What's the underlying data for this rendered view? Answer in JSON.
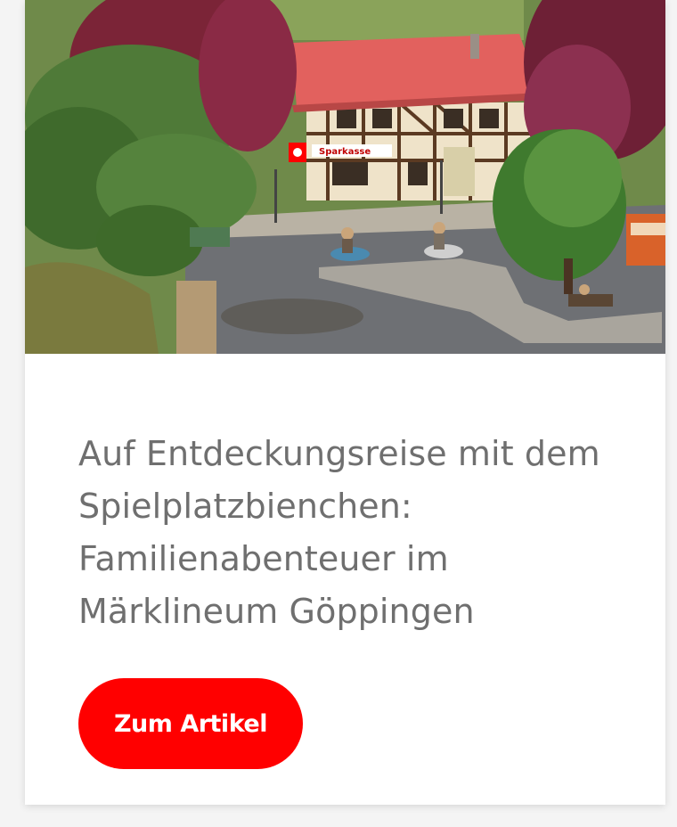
{
  "article_card": {
    "image_alt": "Modelleisenbahn-Szene mit Fachwerkhaus und Sparkasse",
    "image_sign_text": "Sparkasse",
    "title": "Auf Entdeckungsreise mit dem Spielplatzbienchen: Familienabenteuer im Märklineum Göppingen",
    "cta_label": "Zum Artikel",
    "accent_color": "#ff0000",
    "title_color": "#6f6f6f"
  }
}
